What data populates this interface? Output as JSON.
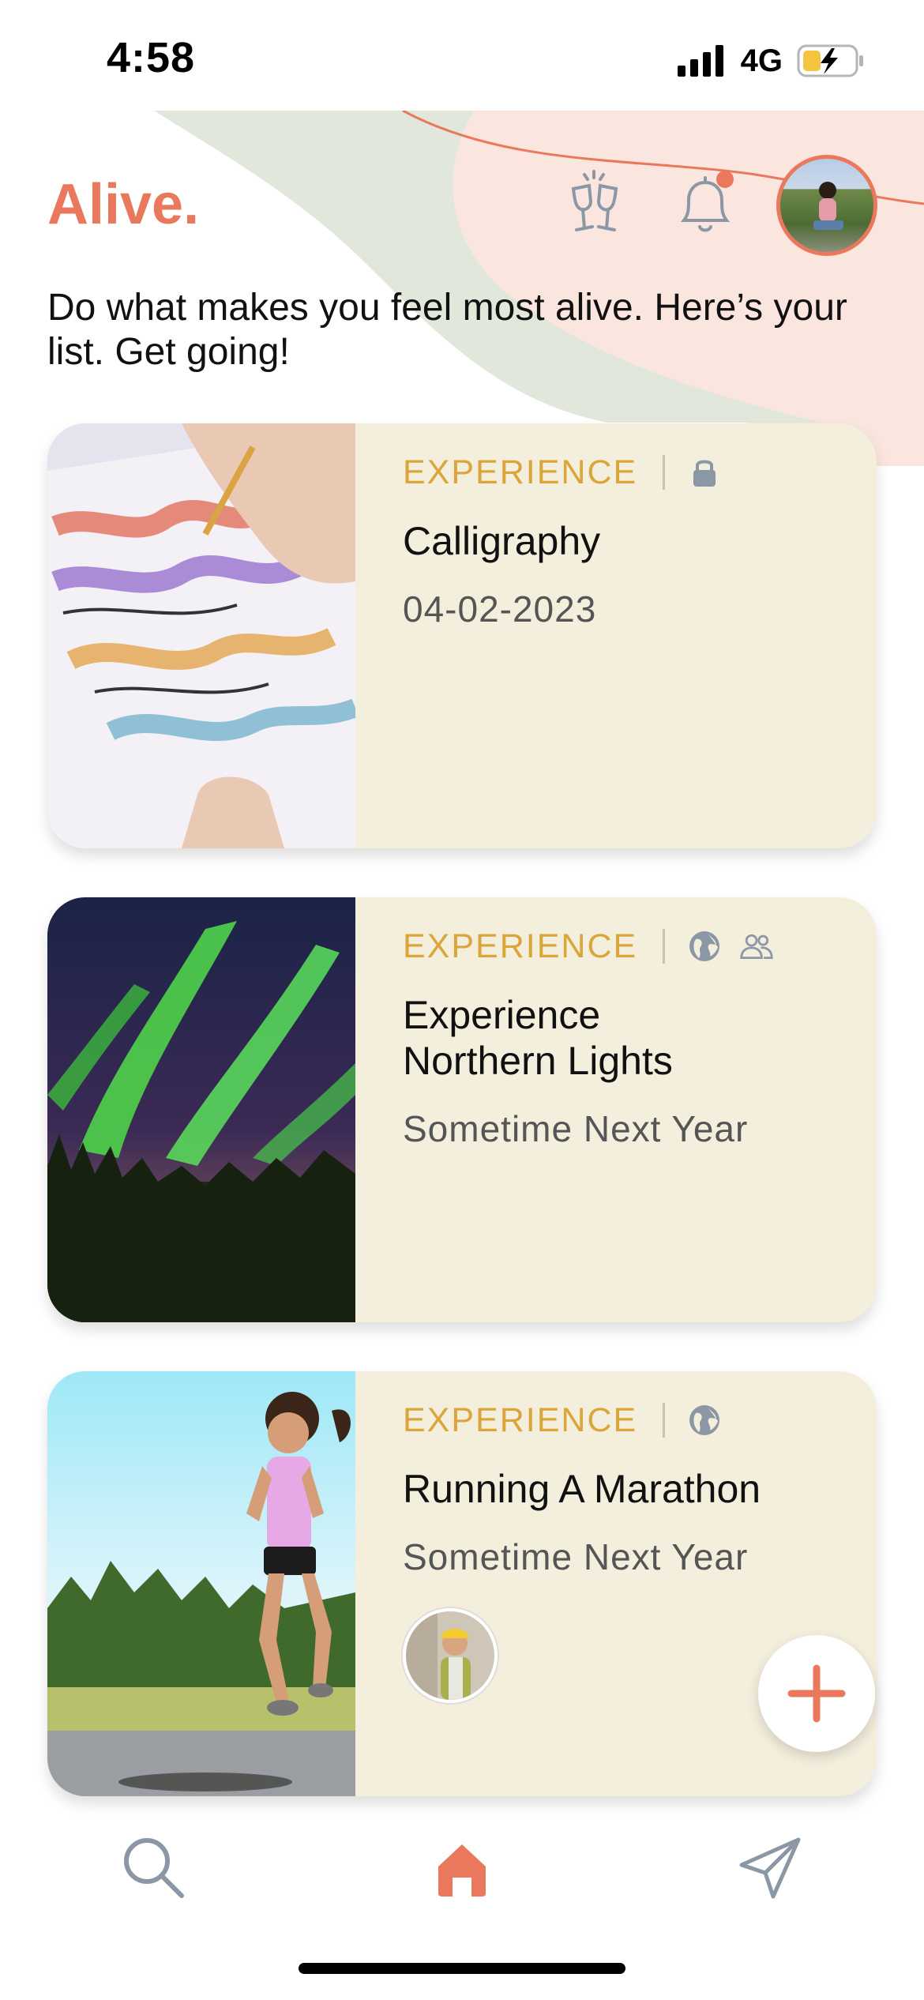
{
  "status_bar": {
    "time": "4:58",
    "network": "4G"
  },
  "header": {
    "brand": "Alive.",
    "tagline": "Do what makes you feel most alive. Here’s your list. Get going!",
    "icons": [
      "cheers-icon",
      "bell-icon",
      "profile-avatar"
    ]
  },
  "cards": [
    {
      "category": "EXPERIENCE",
      "title": "Calligraphy",
      "date": "04-02-2023",
      "icons": [
        "lock-icon"
      ]
    },
    {
      "category": "EXPERIENCE",
      "title": "Experience Northern Lights",
      "date": "Sometime Next Year",
      "icons": [
        "globe-icon",
        "group-icon"
      ]
    },
    {
      "category": "EXPERIENCE",
      "title": "Running A Marathon",
      "date": "Sometime Next Year",
      "icons": [
        "globe-icon"
      ],
      "participants": 1
    }
  ],
  "tab_bar": {
    "items": [
      "search-icon",
      "home-icon",
      "send-icon"
    ],
    "active": "home-icon"
  },
  "colors": {
    "accent": "#E9785C",
    "category": "#DAA53A",
    "card_bg": "#F4EEDD",
    "deco_green": "#E1E7DB",
    "deco_pink": "#FBE6DF",
    "icon_gray": "#8C97A6"
  }
}
